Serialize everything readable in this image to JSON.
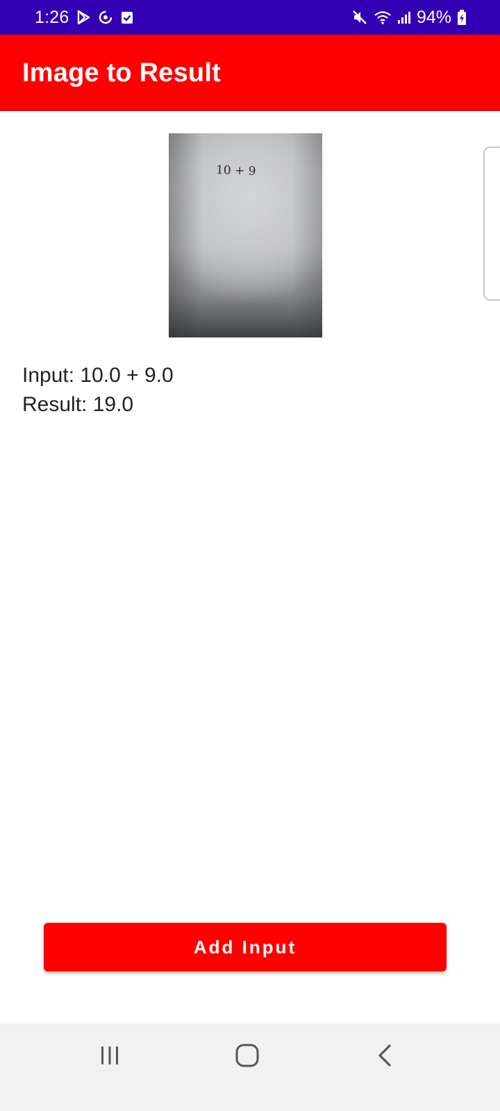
{
  "status_bar": {
    "time": "1:26",
    "battery": "94%",
    "left_icons": [
      "play-store-icon",
      "sync-icon",
      "task-check-icon"
    ],
    "right_icons": [
      "mute-icon",
      "wifi-icon",
      "signal-icon",
      "battery-charging-icon"
    ],
    "background": "#3300b3"
  },
  "app_bar": {
    "title": "Image to Result",
    "background": "#ff0000"
  },
  "photo": {
    "handwritten_text": "10 + 9"
  },
  "result": {
    "input_line": "Input: 10.0 + 9.0",
    "result_line": "Result: 19.0"
  },
  "actions": {
    "add_input_label": "Add Input",
    "button_color": "#ff0000"
  },
  "nav_bar": {
    "items": [
      "recents-icon",
      "home-icon",
      "back-icon"
    ],
    "background": "#f1f1f1"
  }
}
